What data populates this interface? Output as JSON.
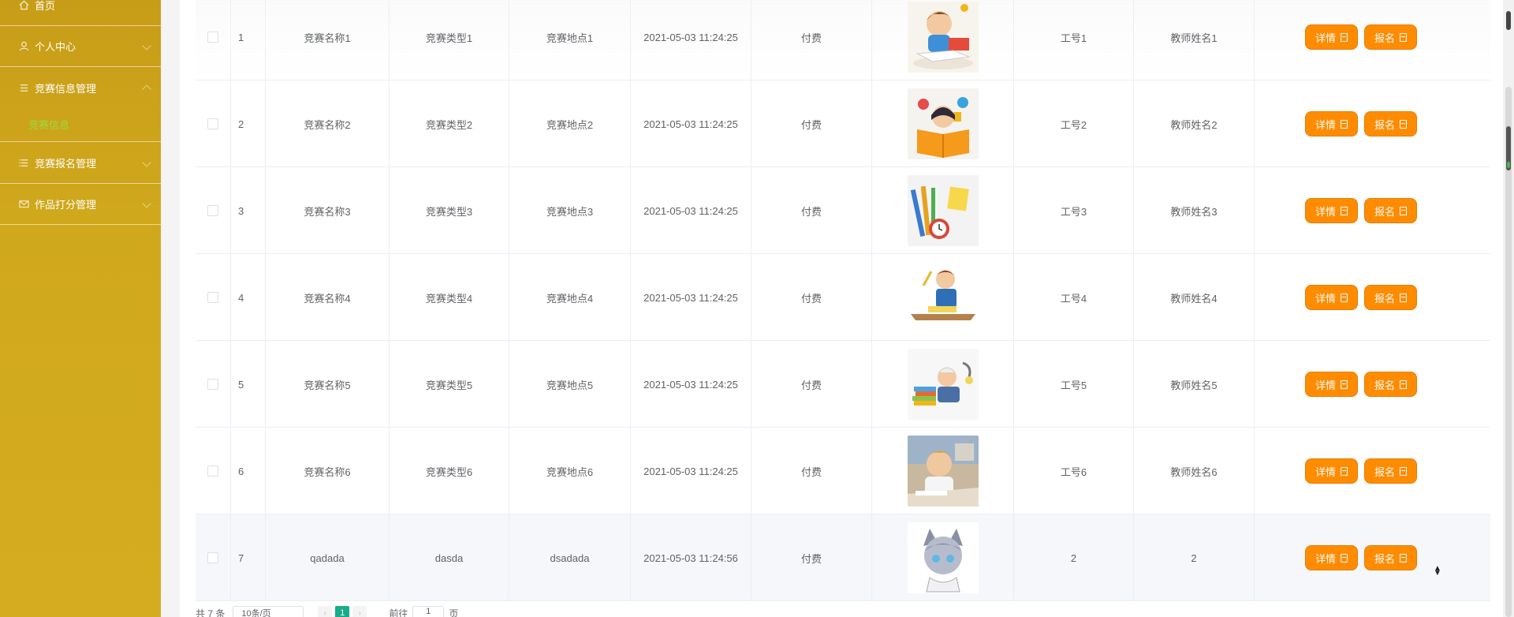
{
  "sidebar": {
    "items": [
      {
        "label": "首页",
        "icon": "home-icon"
      },
      {
        "label": "个人中心",
        "icon": "user-icon"
      },
      {
        "label": "竞赛信息管理",
        "icon": "list-icon",
        "sub": [
          "竞赛信息"
        ]
      },
      {
        "label": "竞赛报名管理",
        "icon": "list-icon"
      },
      {
        "label": "作品打分管理",
        "icon": "mail-icon"
      }
    ]
  },
  "table": {
    "rows": [
      {
        "index": "1",
        "name": "竞赛名称1",
        "type": "竞赛类型1",
        "place": "竞赛地点1",
        "time": "2021-05-03 11:24:25",
        "fee": "付费",
        "work_no": "工号1",
        "teacher": "教师姓名1",
        "image": "child-reading"
      },
      {
        "index": "2",
        "name": "竞赛名称2",
        "type": "竞赛类型2",
        "place": "竞赛地点2",
        "time": "2021-05-03 11:24:25",
        "fee": "付费",
        "work_no": "工号2",
        "teacher": "教师姓名2",
        "image": "girl-book"
      },
      {
        "index": "3",
        "name": "竞赛名称3",
        "type": "竞赛类型3",
        "place": "竞赛地点3",
        "time": "2021-05-03 11:24:25",
        "fee": "付费",
        "work_no": "工号3",
        "teacher": "教师姓名3",
        "image": "stationery"
      },
      {
        "index": "4",
        "name": "竞赛名称4",
        "type": "竞赛类型4",
        "place": "竞赛地点4",
        "time": "2021-05-03 11:24:25",
        "fee": "付费",
        "work_no": "工号4",
        "teacher": "教师姓名4",
        "image": "boy-desk"
      },
      {
        "index": "5",
        "name": "竞赛名称5",
        "type": "竞赛类型5",
        "place": "竞赛地点5",
        "time": "2021-05-03 11:24:25",
        "fee": "付费",
        "work_no": "工号5",
        "teacher": "教师姓名5",
        "image": "old-reader"
      },
      {
        "index": "6",
        "name": "竞赛名称6",
        "type": "竞赛类型6",
        "place": "竞赛地点6",
        "time": "2021-05-03 11:24:25",
        "fee": "付费",
        "work_no": "工号6",
        "teacher": "教师姓名6",
        "image": "kid-photo"
      },
      {
        "index": "7",
        "name": "qadada",
        "type": "dasda",
        "place": "dsadada",
        "time": "2021-05-03 11:24:56",
        "fee": "付费",
        "work_no": "2",
        "teacher": "2",
        "image": "anime-cat"
      }
    ],
    "detail_label": "详情",
    "signup_label": "报名"
  },
  "pager": {
    "total": "共 7 条",
    "page_size": "10条/页",
    "current": "1",
    "goto_prefix": "前往",
    "goto_value": "1",
    "goto_suffix": "页"
  },
  "colors": {
    "sidebar": "#d0a81c",
    "button": "#ff8c00",
    "page_active": "#1aab8a",
    "sub_active": "#9cdb3c"
  }
}
